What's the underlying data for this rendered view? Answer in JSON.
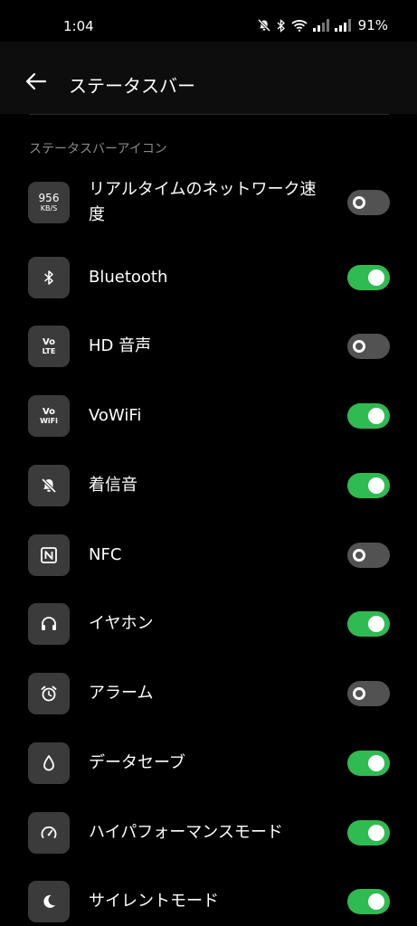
{
  "status_bar": {
    "time": "1:04",
    "battery": "91%"
  },
  "header": {
    "title": "ステータスバー"
  },
  "section": {
    "title": "ステータスバーアイコン"
  },
  "items": [
    {
      "label": "リアルタイムのネットワーク速度",
      "icon": "network-speed-icon",
      "icon_text_1": "956",
      "icon_text_2": "KB/S",
      "enabled": false
    },
    {
      "label": "Bluetooth",
      "icon": "bluetooth-icon",
      "enabled": true
    },
    {
      "label": "HD 音声",
      "icon": "volte-icon",
      "icon_text_1": "Vo",
      "icon_text_2": "LTE",
      "enabled": false
    },
    {
      "label": "VoWiFi",
      "icon": "vowifi-icon",
      "icon_text_1": "Vo",
      "icon_text_2": "WiFi",
      "enabled": true
    },
    {
      "label": "着信音",
      "icon": "bell-off-icon",
      "enabled": true
    },
    {
      "label": "NFC",
      "icon": "nfc-icon",
      "enabled": false
    },
    {
      "label": "イヤホン",
      "icon": "headphones-icon",
      "enabled": true
    },
    {
      "label": "アラーム",
      "icon": "alarm-icon",
      "enabled": false
    },
    {
      "label": "データセーブ",
      "icon": "data-saver-icon",
      "enabled": true
    },
    {
      "label": "ハイパフォーマンスモード",
      "icon": "performance-icon",
      "enabled": true
    },
    {
      "label": "サイレントモード",
      "icon": "moon-icon",
      "enabled": true
    }
  ],
  "colors": {
    "background": "#000000",
    "toggle_on": "#2fba52",
    "toggle_off": "#525252",
    "icon_tile": "#3b3b3b"
  }
}
